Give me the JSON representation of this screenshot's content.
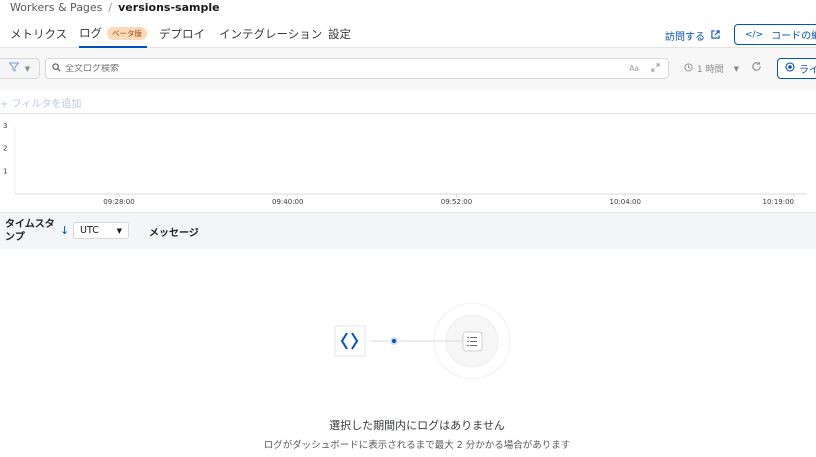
{
  "breadcrumb": {
    "parent": "Workers & Pages",
    "separator": "/",
    "current": "versions-sample"
  },
  "tabs": [
    {
      "label": "メトリクス",
      "active": false
    },
    {
      "label": "ログ",
      "active": true,
      "badge": "ベータ版"
    },
    {
      "label": "デプロイ",
      "active": false
    },
    {
      "label": "インテグレーション",
      "active": false
    },
    {
      "label": "設定",
      "active": false
    }
  ],
  "header_actions": {
    "visit_label": "訪問する",
    "edit_code_label": "コードの編集"
  },
  "toolbar": {
    "search_placeholder": "全文ログ検索",
    "match_case_label": "Aa",
    "time_range": "1 時間",
    "live_label": "ライブ"
  },
  "filters": {
    "add_filter_label": "+ フィルタを追加"
  },
  "chart_data": {
    "type": "bar",
    "x_ticks": [
      "09:28:00",
      "09:40:00",
      "09:52:00",
      "10:04:00",
      "10:19:00"
    ],
    "y_ticks": [
      1,
      2,
      3
    ],
    "ylim": [
      0,
      3
    ],
    "series": [
      {
        "values": []
      }
    ],
    "grid": false
  },
  "table": {
    "timestamp_header": "タイムスタンプ",
    "timezone": "UTC",
    "message_header": "メッセージ"
  },
  "empty_state": {
    "title": "選択した期間内にログはありません",
    "subtitle": "ログがダッシュボードに表示されるまで最大 2 分かかる場合があります"
  },
  "colors": {
    "accent": "#0051c3",
    "badge_bg": "#fcd9b8",
    "badge_text": "#9a4a00"
  }
}
